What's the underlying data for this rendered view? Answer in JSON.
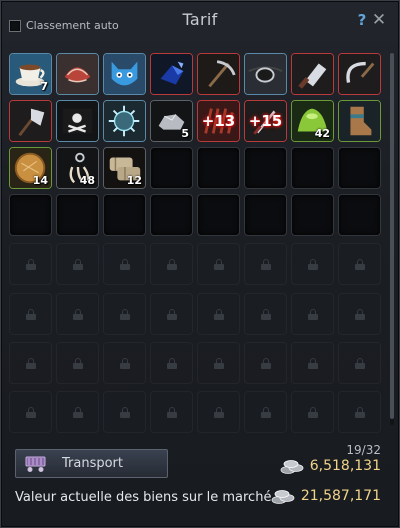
{
  "window": {
    "title": "Tarif",
    "auto_sort_label": "Classement auto",
    "help_label": "?",
    "close_label": "✕"
  },
  "slots": [
    {
      "name": "tea-cup",
      "qty": "7",
      "rarity": "r-common"
    },
    {
      "name": "red-bandana",
      "qty": "",
      "rarity": "r-common"
    },
    {
      "name": "blue-cat-mask",
      "qty": "",
      "rarity": "r-common"
    },
    {
      "name": "blue-crystal",
      "qty": "",
      "rarity": "r-rare"
    },
    {
      "name": "pickaxe",
      "qty": "",
      "rarity": "r-rare"
    },
    {
      "name": "eye-patch",
      "qty": "",
      "rarity": "r-common"
    },
    {
      "name": "butcher-knife",
      "qty": "",
      "rarity": "r-rare"
    },
    {
      "name": "sickle",
      "qty": "",
      "rarity": "r-rare"
    },
    {
      "name": "axe",
      "qty": "",
      "rarity": "r-rare"
    },
    {
      "name": "pirate-flag",
      "qty": "",
      "rarity": "r-common"
    },
    {
      "name": "spiky-orb",
      "qty": "",
      "rarity": "r-common"
    },
    {
      "name": "silver-ore",
      "qty": "5",
      "rarity": "r-gray"
    },
    {
      "name": "red-claw",
      "enh": "+13",
      "rarity": "r-rare"
    },
    {
      "name": "dagger",
      "enh": "+15",
      "rarity": "r-rare"
    },
    {
      "name": "green-slime",
      "qty": "42",
      "rarity": "r-green"
    },
    {
      "name": "leather-boot",
      "qty": "",
      "rarity": "r-green"
    },
    {
      "name": "bread-loaf",
      "qty": "14",
      "rarity": "r-green"
    },
    {
      "name": "claw-hook",
      "qty": "48",
      "rarity": "r-gray"
    },
    {
      "name": "sack-bundle",
      "qty": "12",
      "rarity": "r-gray"
    }
  ],
  "footer": {
    "transport_label": "Transport",
    "capacity": "19/32",
    "silver_balance": "6,518,131",
    "market_label": "Valeur actuelle des biens sur le marché",
    "market_value": "21,587,171"
  },
  "colors": {
    "accent_help": "#63a4d8",
    "silver_text": "#f0d48a",
    "rare_border": "#b83a3a",
    "common_border": "#5b8aa8",
    "green_border": "#6a9a3a"
  }
}
